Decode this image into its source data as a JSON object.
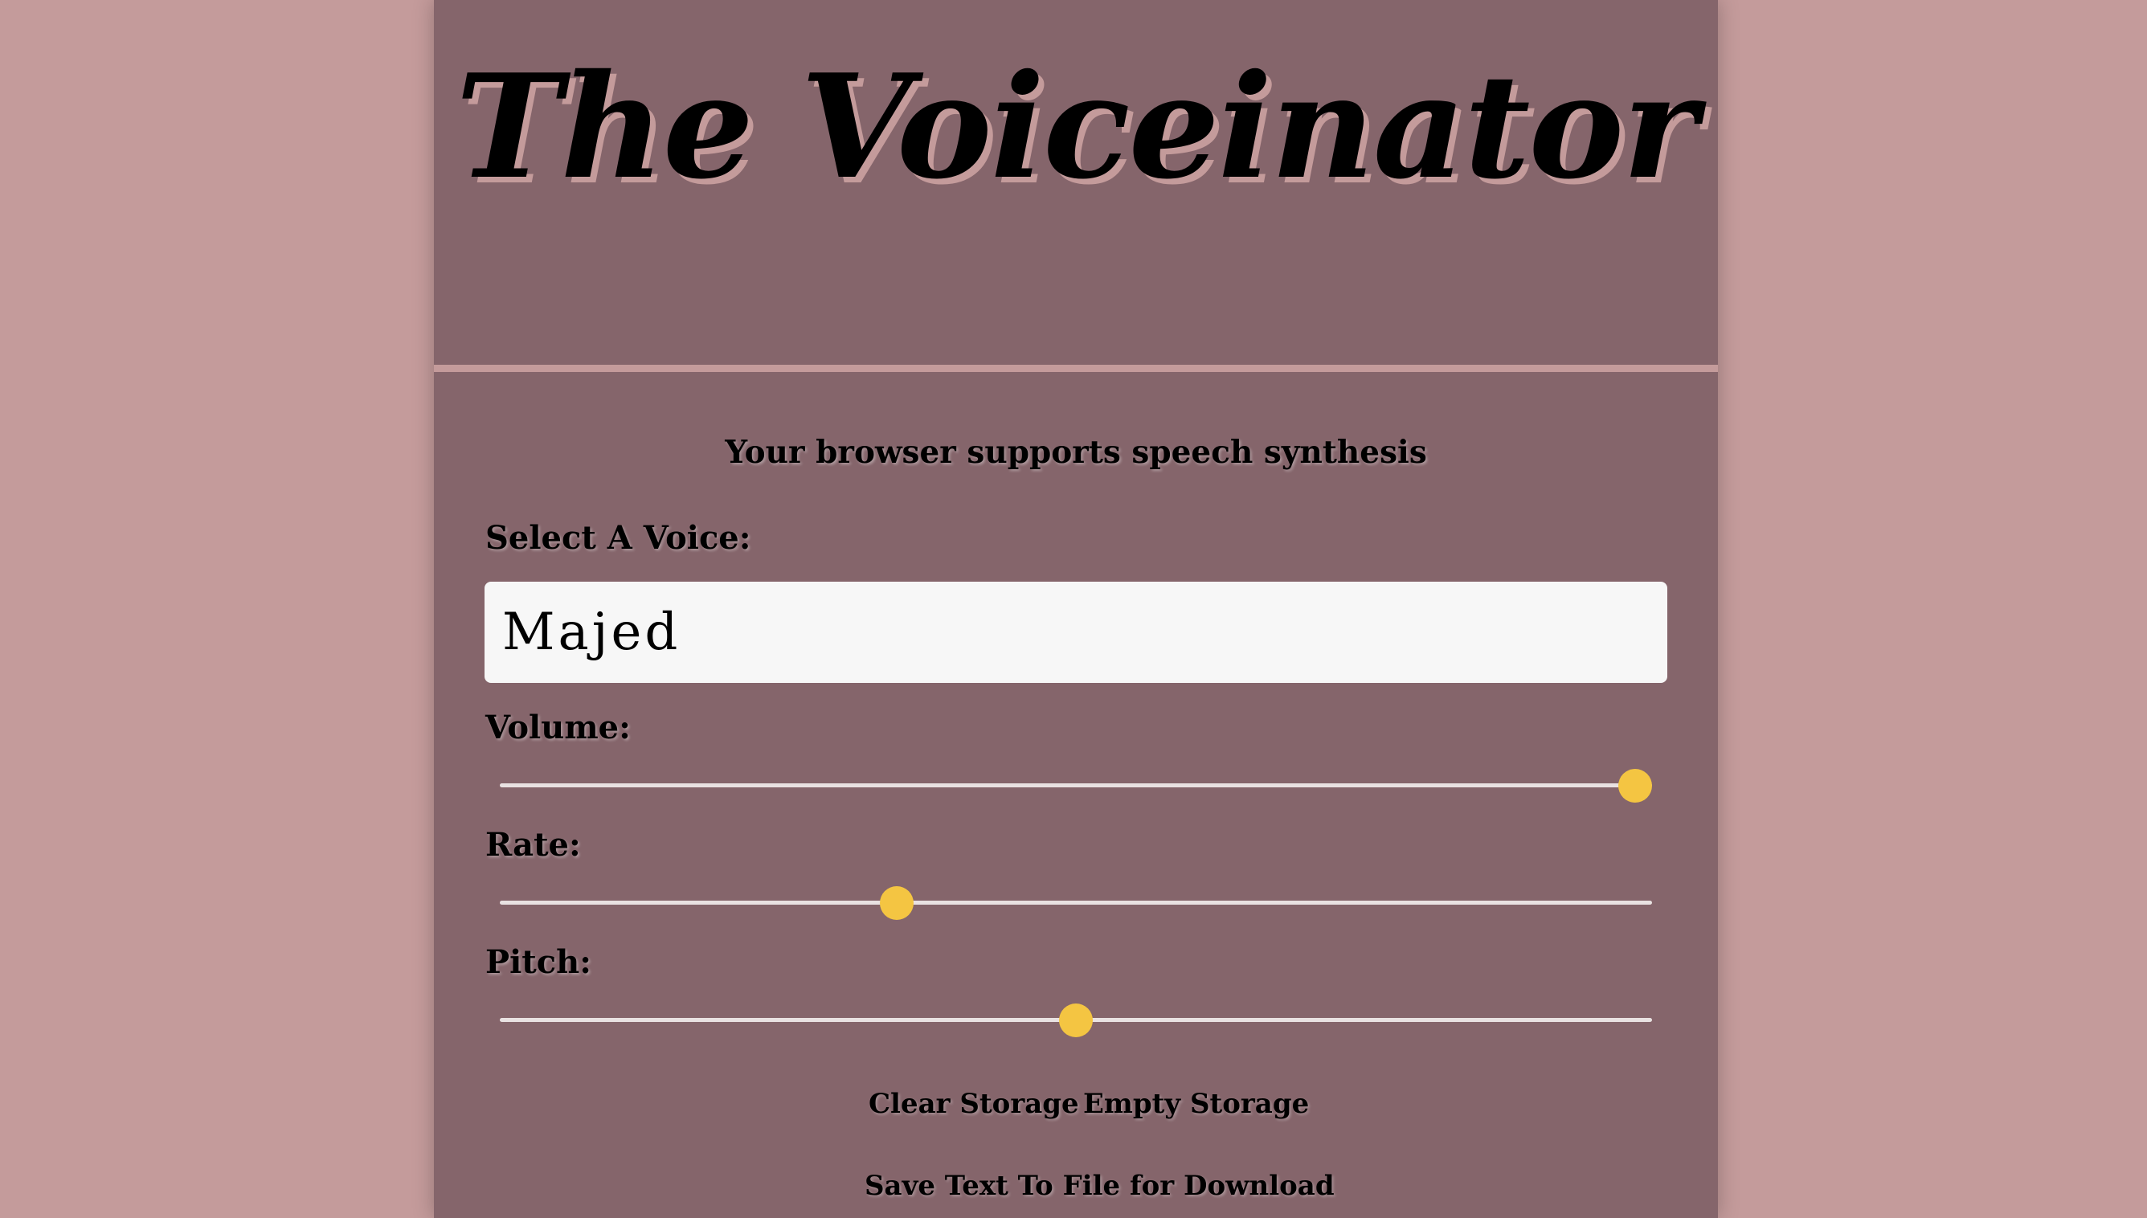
{
  "app": {
    "title": "The Voiceinator"
  },
  "status": {
    "support_message": "Your browser supports speech synthesis"
  },
  "voice": {
    "label": "Select A Voice:",
    "selected": "Majed"
  },
  "controls": {
    "volume": {
      "label": "Volume:",
      "value_fraction": 1.0
    },
    "rate": {
      "label": "Rate:",
      "value_fraction": 0.34
    },
    "pitch": {
      "label": "Pitch:",
      "value_fraction": 0.5
    }
  },
  "buttons": {
    "clear_storage": "Clear Storage",
    "empty_storage": "Empty Storage",
    "save_text": "Save Text To File for Download"
  },
  "colors": {
    "background": "#c49b9b",
    "panel": "#85656b",
    "accent_thumb": "#f4c542",
    "track": "#e9e2e2"
  }
}
